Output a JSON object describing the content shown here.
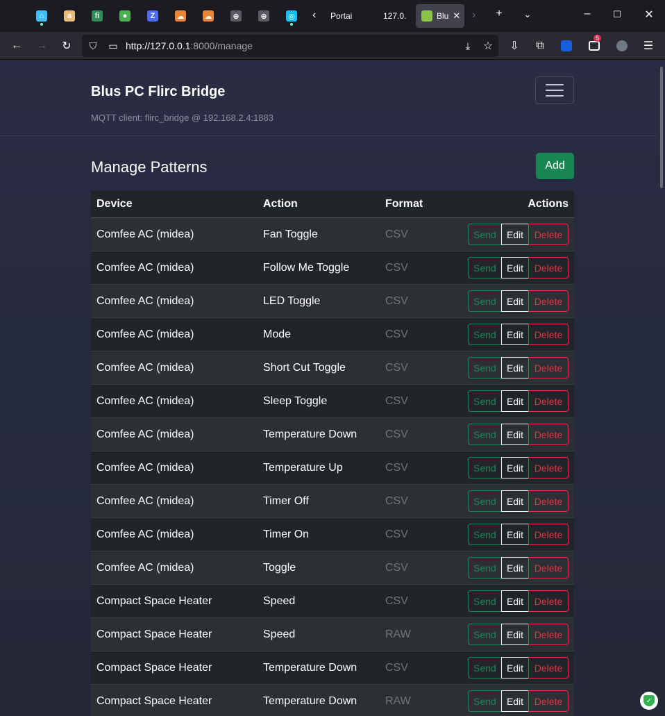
{
  "browser": {
    "tabs": [
      {
        "label": "Portai",
        "active": false
      },
      {
        "label": "127.0.",
        "active": false
      },
      {
        "label": "Blu",
        "active": true
      }
    ],
    "url_host": "http://127.0.0.1",
    "url_rest": ":8000/manage",
    "extension_badge": "5",
    "pinned_tabs": [
      {
        "icon": "home-assistant-icon",
        "color": "#41bdf5",
        "glyph": "⌂"
      },
      {
        "icon": "amazon-icon",
        "color": "#e9ba7b",
        "glyph": "a"
      },
      {
        "icon": "fi-icon",
        "color": "#2e8b57",
        "glyph": "fi"
      },
      {
        "icon": "green-dot-icon",
        "color": "#4caf50",
        "glyph": "●"
      },
      {
        "icon": "z-icon",
        "color": "#4a6cf7",
        "glyph": "Z"
      },
      {
        "icon": "cloud-icon",
        "color": "#e8833a",
        "glyph": "☁"
      },
      {
        "icon": "cloud-icon",
        "color": "#e8833a",
        "glyph": "☁"
      },
      {
        "icon": "globe-icon",
        "color": "#5b5b66",
        "glyph": "⊕"
      },
      {
        "icon": "globe-icon",
        "color": "#5b5b66",
        "glyph": "⊕"
      },
      {
        "icon": "portainer-icon",
        "color": "#13bef9",
        "glyph": "◎"
      }
    ]
  },
  "app": {
    "brand": "Blus PC Flirc Bridge",
    "mqtt_status": "MQTT client: flirc_bridge @ 192.168.2.4:1883",
    "page_title": "Manage Patterns",
    "add_label": "Add"
  },
  "table": {
    "headers": {
      "device": "Device",
      "action": "Action",
      "format": "Format",
      "actions": "Actions"
    },
    "buttons": {
      "send": "Send",
      "edit": "Edit",
      "delete": "Delete"
    },
    "rows": [
      {
        "device": "Comfee AC (midea)",
        "action": "Fan Toggle",
        "format": "CSV"
      },
      {
        "device": "Comfee AC (midea)",
        "action": "Follow Me Toggle",
        "format": "CSV"
      },
      {
        "device": "Comfee AC (midea)",
        "action": "LED Toggle",
        "format": "CSV"
      },
      {
        "device": "Comfee AC (midea)",
        "action": "Mode",
        "format": "CSV"
      },
      {
        "device": "Comfee AC (midea)",
        "action": "Short Cut Toggle",
        "format": "CSV"
      },
      {
        "device": "Comfee AC (midea)",
        "action": "Sleep Toggle",
        "format": "CSV"
      },
      {
        "device": "Comfee AC (midea)",
        "action": "Temperature Down",
        "format": "CSV"
      },
      {
        "device": "Comfee AC (midea)",
        "action": "Temperature Up",
        "format": "CSV"
      },
      {
        "device": "Comfee AC (midea)",
        "action": "Timer Off",
        "format": "CSV"
      },
      {
        "device": "Comfee AC (midea)",
        "action": "Timer On",
        "format": "CSV"
      },
      {
        "device": "Comfee AC (midea)",
        "action": "Toggle",
        "format": "CSV"
      },
      {
        "device": "Compact Space Heater",
        "action": "Speed",
        "format": "CSV"
      },
      {
        "device": "Compact Space Heater",
        "action": "Speed",
        "format": "RAW"
      },
      {
        "device": "Compact Space Heater",
        "action": "Temperature Down",
        "format": "CSV"
      },
      {
        "device": "Compact Space Heater",
        "action": "Temperature Down",
        "format": "RAW"
      }
    ]
  },
  "colors": {
    "success": "#198754",
    "danger": "#dc3545",
    "light": "#f8f9fa",
    "muted": "#6c757d"
  }
}
